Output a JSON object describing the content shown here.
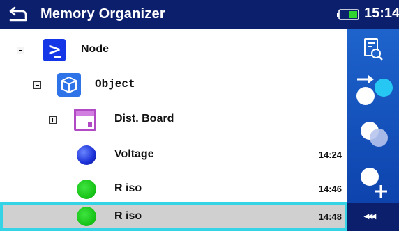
{
  "header": {
    "title": "Memory Organizer",
    "time": "15:14",
    "back_icon": "back-arrow-icon",
    "battery_icon": "battery-icon"
  },
  "tree": {
    "rows": [
      {
        "label": "Node",
        "icon": "node-icon",
        "expander": "minus",
        "time": ""
      },
      {
        "label": "Object",
        "icon": "object-cube-icon",
        "expander": "minus",
        "time": ""
      },
      {
        "label": "Dist. Board",
        "icon": "dist-board-icon",
        "expander": "plus",
        "time": ""
      },
      {
        "label": "Voltage",
        "icon": "blue-ball-icon",
        "expander": "",
        "time": "14:24"
      },
      {
        "label": "R iso",
        "icon": "green-ball-icon",
        "expander": "",
        "time": "14:46"
      },
      {
        "label": "R iso",
        "icon": "green-ball-icon",
        "expander": "",
        "time": "14:48",
        "selected": true
      }
    ]
  },
  "panel": {
    "buttons": [
      "view-results-icon",
      "start-test-icon",
      "clone-test-icon",
      "add-test-icon",
      "more-options-icon"
    ],
    "more_label": "◂◂◂"
  },
  "colors": {
    "header_bg": "#0c1f6d",
    "panel_bg": "#1e63cc",
    "selection_border": "#35d3e6",
    "selection_bg": "#d0d0d0"
  }
}
